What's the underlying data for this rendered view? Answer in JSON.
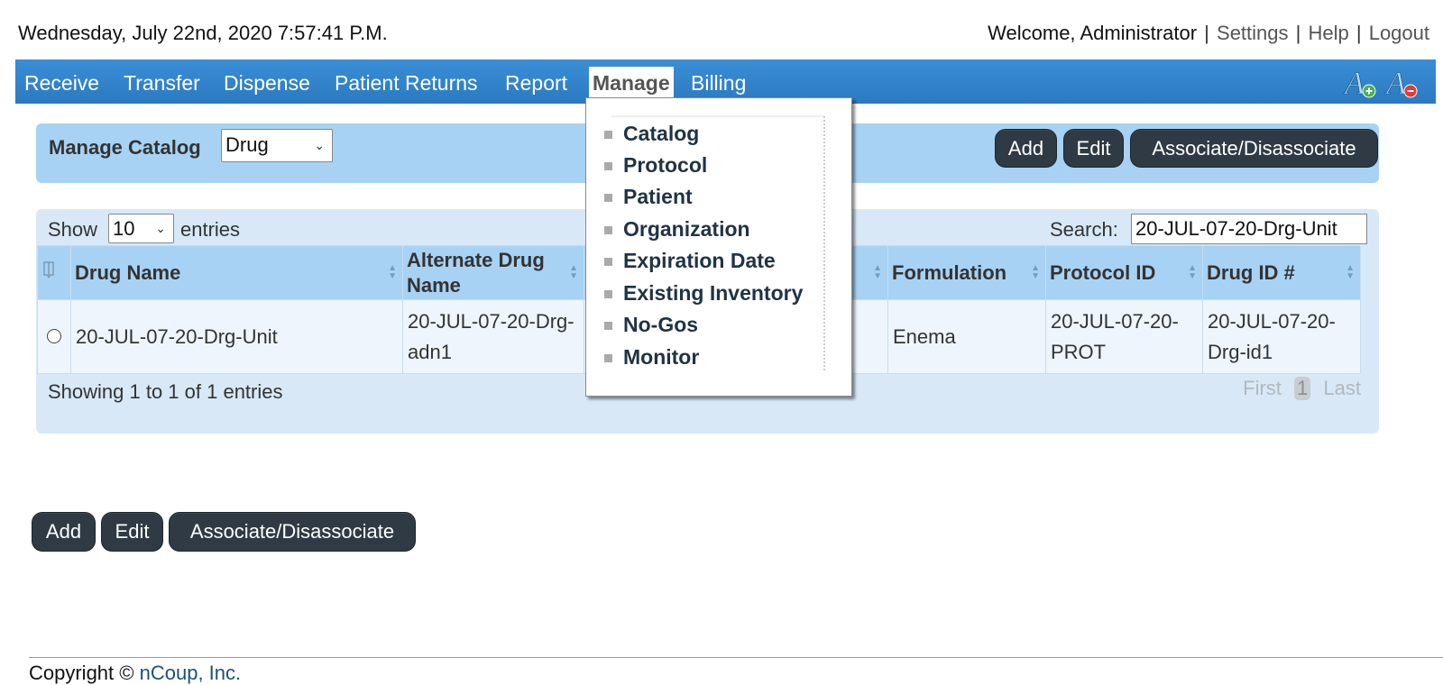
{
  "header": {
    "datetime": "Wednesday, July 22nd, 2020 7:57:41 P.M.",
    "welcome": "Welcome, Administrator",
    "sep": "|",
    "links": [
      "Settings",
      "Help",
      "Logout"
    ]
  },
  "nav": {
    "items": [
      "Receive",
      "Transfer",
      "Dispense",
      "Patient Returns",
      "Report",
      "Manage",
      "Billing"
    ],
    "active": "Manage",
    "icons": [
      "font-increase-icon",
      "font-decrease-icon"
    ]
  },
  "catalog": {
    "label": "Manage Catalog",
    "select_value": "Drug",
    "buttons": [
      "Add",
      "Edit",
      "Associate/Disassociate"
    ]
  },
  "table": {
    "show_label": "Show",
    "page_size": "10",
    "entries_label": "entries",
    "search_label": "Search:",
    "search_value": "20-JUL-07-20-Drg-Unit",
    "columns": [
      "Drug Name",
      "Alternate Drug Name",
      "",
      "Formulation",
      "Protocol ID",
      "Drug ID #"
    ],
    "rows": [
      [
        "20-JUL-07-20-Drg-Unit",
        "20-JUL-07-20-Drg-adn1",
        "",
        "Enema",
        "20-JUL-07-20-PROT",
        "20-JUL-07-20-Drg-id1"
      ]
    ],
    "info": "Showing 1 to 1 of 1 entries",
    "pager": {
      "first": "First",
      "current": "1",
      "last": "Last"
    }
  },
  "manage_menu": {
    "items": [
      "Catalog",
      "Protocol",
      "Patient",
      "Organization",
      "Expiration Date",
      "Existing Inventory",
      "No-Gos",
      "Monitor"
    ]
  },
  "bottom_buttons": [
    "Add",
    "Edit",
    "Associate/Disassociate"
  ],
  "footer": {
    "copyright": "Copyright ©",
    "company": "nCoup, Inc."
  },
  "colors": {
    "nav_bg": "#2f82ca",
    "panel_bg": "#a8d2f3",
    "table_panel_bg": "#d8e8f7",
    "button_bg": "#2f3a44"
  }
}
